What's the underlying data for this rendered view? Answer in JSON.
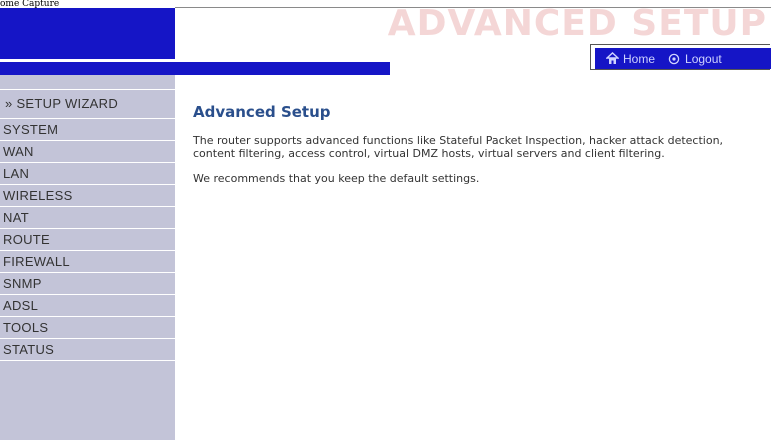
{
  "header": {
    "broken_image_label": "ome Capture",
    "banner_title": "ADVANCED SETUP",
    "nav": {
      "home_label": "Home",
      "logout_label": "Logout"
    }
  },
  "sidebar": {
    "header_label": "» SETUP WIZARD",
    "items": [
      "SYSTEM",
      "WAN",
      "LAN",
      "WIRELESS",
      "NAT",
      "ROUTE",
      "FIREWALL",
      "SNMP",
      "ADSL",
      "TOOLS",
      "STATUS"
    ]
  },
  "main": {
    "title": "Advanced Setup",
    "paragraph1": "The router supports advanced functions like Stateful Packet Inspection, hacker attack detection, content filtering, access control, virtual DMZ hosts, virtual servers and client filtering.",
    "paragraph2": "We recommends that you keep the default settings."
  },
  "colors": {
    "brand_blue": "#1515c6",
    "sidebar_bg": "#c3c4d8",
    "title_blue": "#2a4f8c",
    "banner_pink": "#f4d6d6"
  }
}
